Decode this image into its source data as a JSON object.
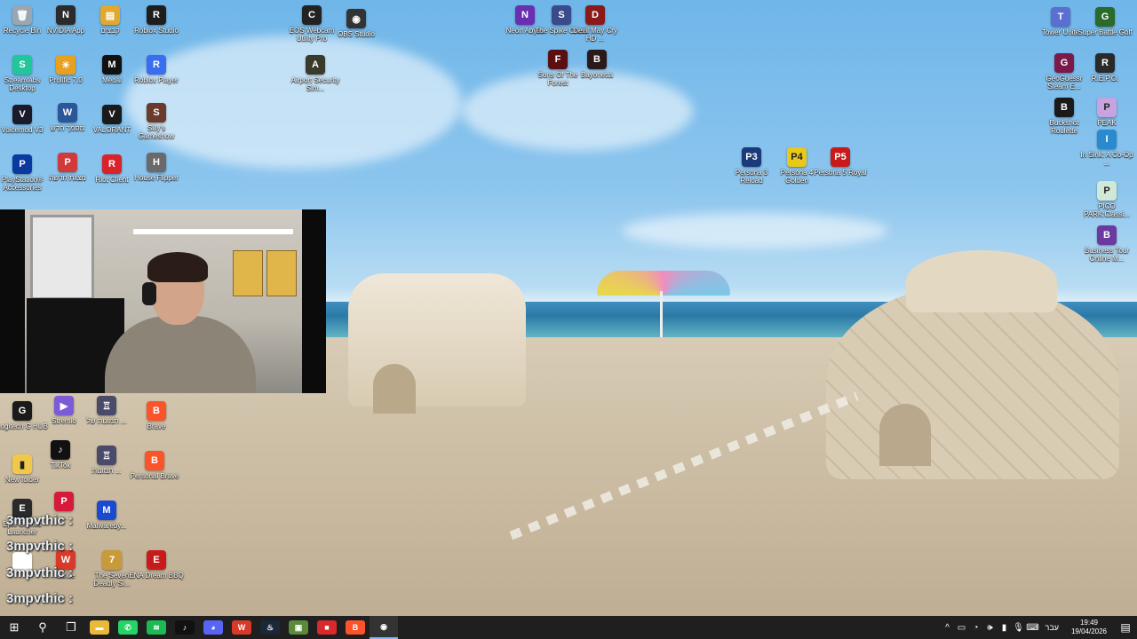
{
  "desktop_icons": [
    {
      "id": "recycle-bin",
      "label": "Recycle Bin",
      "color": "#9aa7b3",
      "glyph": "🗑"
    },
    {
      "id": "nvidia-app",
      "label": "NVIDIA App",
      "color": "#2b2b2b",
      "glyph": "N"
    },
    {
      "id": "hebrew-file-1",
      "label": "קבצים",
      "color": "#e0a82e",
      "glyph": "▤"
    },
    {
      "id": "roblox-studio",
      "label": "Roblox Studio",
      "color": "#1e1e1e",
      "glyph": "R"
    },
    {
      "id": "eos-webcam",
      "label": "EOS Webcam Utility Pro",
      "color": "#222",
      "glyph": "C"
    },
    {
      "id": "obs-studio",
      "label": "OBS Studio",
      "color": "#333",
      "glyph": "◉"
    },
    {
      "id": "neon-abyss",
      "label": "Neon Abyss",
      "color": "#6a2fb0",
      "glyph": "N"
    },
    {
      "id": "spike-cross",
      "label": "The Spike Cross",
      "color": "#3a4a8a",
      "glyph": "S"
    },
    {
      "id": "devil-may-cry",
      "label": "Devil May Cry HD ...",
      "color": "#8a1a1a",
      "glyph": "D"
    },
    {
      "id": "tower-unite",
      "label": "Tower Unite",
      "color": "#5a6fd0",
      "glyph": "T"
    },
    {
      "id": "super-battle-golf",
      "label": "Super Battle Golf",
      "color": "#2a6a2a",
      "glyph": "G"
    },
    {
      "id": "streamlabs",
      "label": "Streamlabs Desktop",
      "color": "#21c79a",
      "glyph": "S"
    },
    {
      "id": "prolific",
      "label": "Prolific 7.0",
      "color": "#e8a020",
      "glyph": "☀"
    },
    {
      "id": "medal",
      "label": "Medal",
      "color": "#111",
      "glyph": "M"
    },
    {
      "id": "roblox-player",
      "label": "Roblox Player",
      "color": "#3a6ef0",
      "glyph": "R"
    },
    {
      "id": "airport-security",
      "label": "Airport Security Sim...",
      "color": "#3a3a2a",
      "glyph": "A"
    },
    {
      "id": "sons-of-the-forest",
      "label": "Sons Of The Forest",
      "color": "#5a1010",
      "glyph": "F"
    },
    {
      "id": "bayonetta",
      "label": "Bayonetta",
      "color": "#2a1a1a",
      "glyph": "B"
    },
    {
      "id": "geoguessr",
      "label": "GeoGuessr Steam E...",
      "color": "#7a1a4a",
      "glyph": "G"
    },
    {
      "id": "repo",
      "label": "R.E.P.O.",
      "color": "#2a2a2a",
      "glyph": "R"
    },
    {
      "id": "voicemod",
      "label": "Voicemod V3",
      "color": "#1a1a2a",
      "glyph": "V"
    },
    {
      "id": "word-doc",
      "label": "מסמך חדש",
      "color": "#2b579a",
      "glyph": "W"
    },
    {
      "id": "valorant",
      "label": "VALORANT",
      "color": "#1a1a1a",
      "glyph": "V"
    },
    {
      "id": "sillys-gameshow",
      "label": "Silly's Gameshow",
      "color": "#6a3a2a",
      "glyph": "S"
    },
    {
      "id": "buckshot-roulette",
      "label": "Buckshot Roulette",
      "color": "#1a1a1a",
      "glyph": "B"
    },
    {
      "id": "peak",
      "label": "PEAK",
      "color": "#c7a4e0",
      "glyph": "P"
    },
    {
      "id": "playstation-accessories",
      "label": "PlayStation® Accessories",
      "color": "#0a3aa0",
      "glyph": "P"
    },
    {
      "id": "hebrew-ppt",
      "label": "מצגת חדשה",
      "color": "#d03a3a",
      "glyph": "P"
    },
    {
      "id": "riot-client",
      "label": "Riot Client",
      "color": "#d8232a",
      "glyph": "R"
    },
    {
      "id": "house-flipper",
      "label": "House Flipper",
      "color": "#6a6a6a",
      "glyph": "H"
    },
    {
      "id": "persona-3",
      "label": "Persona 3 Reload",
      "color": "#1a3a7a",
      "glyph": "P3"
    },
    {
      "id": "persona-4",
      "label": "Persona 4 Golden",
      "color": "#e8c81a",
      "glyph": "P4"
    },
    {
      "id": "persona-5",
      "label": "Persona 5 Royal",
      "color": "#c81a1a",
      "glyph": "P5"
    },
    {
      "id": "in-sink",
      "label": "In Sink: A Co-Op ...",
      "color": "#2a8ad0",
      "glyph": "I"
    },
    {
      "id": "pico-park",
      "label": "PICO PARK:Classi...",
      "color": "#d0e8d8",
      "glyph": "P"
    },
    {
      "id": "business-tour",
      "label": "Business Tour Online M...",
      "color": "#6a3aa0",
      "glyph": "B"
    },
    {
      "id": "logitech-g-hub",
      "label": "Logitech G HUB",
      "color": "#1a1a1a",
      "glyph": "G"
    },
    {
      "id": "stremio",
      "label": "Stremio",
      "color": "#7b5bd6",
      "glyph": "▶"
    },
    {
      "id": "hebrew-shortcut-1",
      "label": "תמונות של ...",
      "color": "#4a4a6a",
      "glyph": "♖"
    },
    {
      "id": "brave",
      "label": "Brave",
      "color": "#fb542b",
      "glyph": "B"
    },
    {
      "id": "new-folder",
      "label": "New folder",
      "color": "#f0c84a",
      "glyph": "▮"
    },
    {
      "id": "tiktok",
      "label": "TikTok",
      "color": "#111",
      "glyph": "♪"
    },
    {
      "id": "hebrew-shortcut-2",
      "label": "תמונות ...",
      "color": "#4a4a6a",
      "glyph": "♖"
    },
    {
      "id": "personal-brave",
      "label": "Personal Brave",
      "color": "#fb542b",
      "glyph": "B"
    },
    {
      "id": "epic-games",
      "label": "Epic Games Launcher",
      "color": "#2a2a2a",
      "glyph": "E"
    },
    {
      "id": "app-red-1",
      "label": "...",
      "color": "#d81a3a",
      "glyph": "P"
    },
    {
      "id": "malwarebytes",
      "label": "Malwareby...",
      "color": "#1a4ad0",
      "glyph": "M"
    },
    {
      "id": "white-doc",
      "label": "",
      "color": "#ffffff",
      "glyph": ""
    },
    {
      "id": "office",
      "label": "Office",
      "color": "#d83a2a",
      "glyph": "W"
    },
    {
      "id": "seven-deadly-sins",
      "label": "The Seven Deadly Si...",
      "color": "#c89a3a",
      "glyph": "7"
    },
    {
      "id": "ena-dream-bbq",
      "label": "ENA Dream BBQ",
      "color": "#c81a1a",
      "glyph": "E"
    }
  ],
  "chat_overlay": [
    "3mpvthic :",
    "3mpvthic :",
    "3mpvthic :",
    "3mpvthic :"
  ],
  "taskbar": {
    "start_icon": "⊞",
    "search_icon": "⚲",
    "task_view_icon": "❐",
    "apps": [
      {
        "id": "file-explorer",
        "color": "#e8b93a",
        "glyph": "▬"
      },
      {
        "id": "whatsapp",
        "color": "#25d366",
        "glyph": "✆"
      },
      {
        "id": "spotify",
        "color": "#1db954",
        "glyph": "≋"
      },
      {
        "id": "tiktok",
        "color": "#111",
        "glyph": "♪"
      },
      {
        "id": "discord",
        "color": "#5865f2",
        "glyph": "◕"
      },
      {
        "id": "office",
        "color": "#d83a2a",
        "glyph": "W"
      },
      {
        "id": "steam",
        "color": "#1b2838",
        "glyph": "♨"
      },
      {
        "id": "minecraft",
        "color": "#5a8a3a",
        "glyph": "▣"
      },
      {
        "id": "app-red",
        "color": "#d82a2a",
        "glyph": "■"
      },
      {
        "id": "brave",
        "color": "#fb542b",
        "glyph": "B"
      },
      {
        "id": "obs",
        "color": "#333",
        "glyph": "◉",
        "active": true
      }
    ],
    "tray": {
      "chevron": "^",
      "lang": "עבר",
      "time": "19:49",
      "date": "19/04/2026",
      "notif_icon": "▤"
    }
  }
}
